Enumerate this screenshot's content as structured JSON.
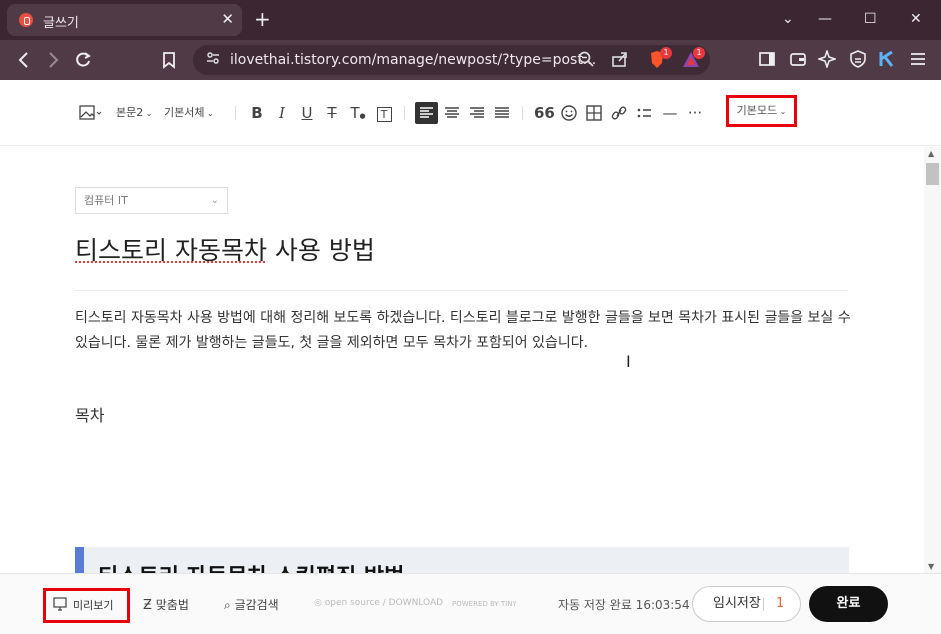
{
  "browser": {
    "tab_title": "글쓰기",
    "tab_close": "✕",
    "new_tab": "+",
    "window_controls": [
      "⌄",
      "—",
      "☐",
      "✕"
    ],
    "url": "ilovethai.tistory.com/manage/newpost/?type=post...",
    "brave_badge": "1",
    "rewards_badge": "1"
  },
  "toolbar": {
    "paragraph_style": "본문2",
    "font": "기본서체",
    "mode": "기본모드"
  },
  "editor": {
    "category": "컴퓨터 IT",
    "title": "티스토리 자동목차 사용 방법",
    "paragraph": "티스토리 자동목차 사용 방법에 대해 정리해 보도록 하겠습니다. 티스토리 블로그로 발행한 글들을 보면 목차가 표시된 글들을 보실 수 있습니다. 물론 제가 발행하는 글들도, 첫 글을 제외하면 모두 목차가 포함되어 있습니다.",
    "toc_label": "목차",
    "heading": "티스토리 자동목차 스킨편집 방법"
  },
  "bottom": {
    "preview": "미리보기",
    "spellcheck": "맞춤법",
    "search": "글감검색",
    "opensource": "open source / DOWNLOAD",
    "powered": "POWERED BY TINY",
    "status": "자동 저장 완료 16:03:54",
    "draft_save": "임시저장",
    "draft_count": "1",
    "publish": "완료"
  },
  "colors": {
    "highlight": "#e8000b",
    "heading_accent": "#5a7cd6",
    "chrome_dark": "#3b2631"
  }
}
